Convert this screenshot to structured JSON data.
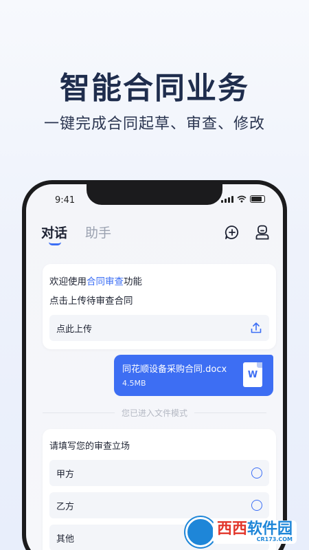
{
  "promo": {
    "title": "智能合同业务",
    "subtitle": "一键完成合同起草、审查、修改"
  },
  "status_bar": {
    "time": "9:41"
  },
  "tabs": [
    {
      "label": "对话",
      "active": true
    },
    {
      "label": "助手",
      "active": false
    }
  ],
  "header_icons": [
    "new-chat-icon",
    "profile-icon"
  ],
  "welcome_card": {
    "line1_prefix": "欢迎使用",
    "line1_highlight": "合同审查",
    "line1_suffix": "功能",
    "line2": "点击上传待审查合同",
    "upload_label": "点此上传",
    "upload_icon": "upload-icon"
  },
  "file_message": {
    "name": "同花顺设备采购合同.docx",
    "size": "4.5MB",
    "icon_letter": "W"
  },
  "divider": {
    "text": "您已进入文件模式"
  },
  "stance_card": {
    "question": "请填写您的审查立场",
    "options": [
      {
        "label": "甲方"
      },
      {
        "label": "乙方"
      },
      {
        "label": "其他"
      }
    ]
  },
  "watermark": {
    "text_red": "西西",
    "text_blue": "软件园",
    "url": "CR173.COM"
  },
  "colors": {
    "accent": "#3b6ef5",
    "title": "#1f2d4d"
  }
}
